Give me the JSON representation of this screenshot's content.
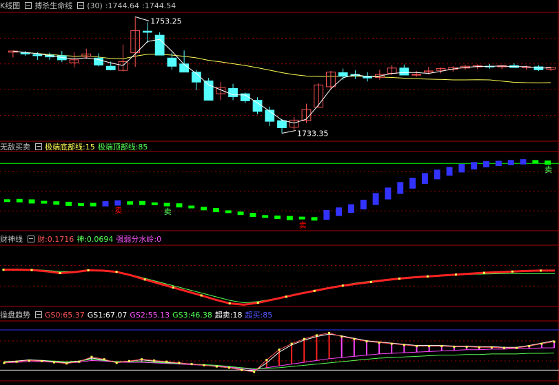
{
  "colors": {
    "up": "#ff5555",
    "down": "#55ffff",
    "line_white": "#ffffff",
    "line_yellow": "#ffff55",
    "green": "#00ff00",
    "blue": "#3333ff",
    "red": "#ff0000",
    "magenta": "#ff44ff",
    "grid": "#aa0000",
    "frame": "#aa0000"
  },
  "panel1": {
    "title": "K线图",
    "indicator": "搏杀生命线",
    "params": "(30)",
    "v1": ":1744.64",
    "v2": ":1744.54",
    "high_label": "1753.25",
    "low_label": "1733.35"
  },
  "panel2": {
    "title": "无敌买卖",
    "ind": "极端底部线",
    "ind_val": ":15",
    "top_label": "极端顶部线",
    "top_val": ":85",
    "sell_text": "卖"
  },
  "panel3": {
    "title": "财神线",
    "cai": "财:0.1716",
    "shen": "神:0.0694",
    "qr": "强弱分水岭:0"
  },
  "panel4": {
    "title": "操盘趋势",
    "gs0": "GS0:65.37",
    "gs1": "GS1:67.07",
    "gs2": "GS2:55.13",
    "gs3": "GS3:46.38",
    "cm": "超卖:18",
    "cb": "超买:85"
  },
  "chart_data": [
    {
      "type": "candlestick",
      "title": "K线图",
      "candles": [
        [
          1747.2,
          1747.4,
          1746.3,
          1747.4
        ],
        [
          1747.1,
          1747.4,
          1746.6,
          1746.9
        ],
        [
          1746.8,
          1747.2,
          1745.9,
          1746.6
        ],
        [
          1746.7,
          1747.1,
          1745.9,
          1746.4
        ],
        [
          1746.6,
          1747.4,
          1745.5,
          1745.9
        ],
        [
          1745.4,
          1747.2,
          1744.6,
          1745.9
        ],
        [
          1746.5,
          1747.8,
          1746.0,
          1746.9
        ],
        [
          1746.2,
          1747.0,
          1744.8,
          1745.0
        ],
        [
          1744.8,
          1745.6,
          1744.1,
          1744.2
        ],
        [
          1744.1,
          1748.5,
          1743.9,
          1745.6
        ],
        [
          1747.1,
          1753.25,
          1744.7,
          1750.9
        ],
        [
          1750.8,
          1752.3,
          1748.8,
          1750.6
        ],
        [
          1750.1,
          1750.6,
          1746.9,
          1746.7
        ],
        [
          1746.2,
          1747.1,
          1744.2,
          1744.8
        ],
        [
          1745.2,
          1747.5,
          1744.0,
          1743.8
        ],
        [
          1743.8,
          1744.2,
          1740.7,
          1742.1
        ],
        [
          1742.3,
          1742.8,
          1739.0,
          1739.0
        ],
        [
          1740.1,
          1742.1,
          1739.0,
          1741.2
        ],
        [
          1741.0,
          1741.8,
          1739.0,
          1739.6
        ],
        [
          1740.1,
          1740.3,
          1738.5,
          1738.9
        ],
        [
          1739.0,
          1739.5,
          1736.6,
          1737.1
        ],
        [
          1737.3,
          1737.9,
          1734.6,
          1735.4
        ],
        [
          1735.5,
          1735.8,
          1733.35,
          1734.3
        ],
        [
          1734.4,
          1736.1,
          1733.9,
          1735.6
        ],
        [
          1735.5,
          1738.4,
          1735.1,
          1737.4
        ],
        [
          1737.8,
          1741.9,
          1737.8,
          1741.6
        ],
        [
          1741.3,
          1744.0,
          1741.0,
          1743.8
        ],
        [
          1743.7,
          1744.4,
          1742.5,
          1743.1
        ],
        [
          1743.4,
          1744.1,
          1742.6,
          1743.2
        ],
        [
          1743.1,
          1743.8,
          1742.2,
          1742.8
        ],
        [
          1742.9,
          1744.2,
          1742.5,
          1743.4
        ],
        [
          1743.6,
          1745.0,
          1743.3,
          1744.5
        ],
        [
          1744.5,
          1745.1,
          1743.3,
          1743.3
        ],
        [
          1743.4,
          1744.0,
          1743.0,
          1743.4
        ],
        [
          1743.8,
          1744.7,
          1743.4,
          1744.0
        ],
        [
          1744.1,
          1744.6,
          1743.6,
          1744.4
        ],
        [
          1744.3,
          1744.8,
          1743.9,
          1744.6
        ],
        [
          1744.5,
          1745.0,
          1744.2,
          1744.8
        ],
        [
          1744.7,
          1745.1,
          1744.3,
          1744.9
        ],
        [
          1744.8,
          1745.2,
          1744.4,
          1744.7
        ],
        [
          1744.7,
          1745.0,
          1744.3,
          1744.9
        ],
        [
          1744.9,
          1745.3,
          1744.6,
          1744.6
        ],
        [
          1744.6,
          1744.9,
          1744.2,
          1744.7
        ],
        [
          1744.7,
          1745.0,
          1744.0,
          1744.2
        ],
        [
          1744.3,
          1744.7,
          1744.0,
          1744.64
        ]
      ],
      "ylim": [
        1732,
        1754
      ]
    },
    {
      "type": "bar",
      "title": "无敌买卖",
      "ylim": [
        0,
        100
      ],
      "ref_lines": [
        15,
        85
      ],
      "values": [
        38,
        38,
        37,
        36,
        35,
        34,
        33,
        33,
        34,
        35,
        35,
        35,
        34,
        33,
        32,
        30,
        28,
        26,
        24,
        22,
        20,
        18,
        17,
        16,
        16,
        15,
        20,
        24,
        28,
        33,
        40,
        47,
        54,
        60,
        66,
        71,
        75,
        79,
        82,
        84,
        85,
        86,
        87,
        87,
        86
      ],
      "sell_markers": [
        9,
        13,
        24,
        44
      ]
    },
    {
      "type": "line",
      "title": "财神线",
      "ylim": [
        -1,
        1
      ],
      "series": [
        {
          "name": "财",
          "values": [
            0.2,
            0.2,
            0.19,
            0.15,
            0.09,
            0.12,
            0.18,
            0.17,
            0.13,
            0.02,
            -0.12,
            -0.25,
            -0.38,
            -0.51,
            -0.64,
            -0.78,
            -0.9,
            -0.94,
            -0.88,
            -0.78,
            -0.68,
            -0.58,
            -0.49,
            -0.4,
            -0.32,
            -0.26,
            -0.2,
            -0.14,
            -0.09,
            -0.05,
            -0.02,
            0.01,
            0.04,
            0.07,
            0.1,
            0.12,
            0.14,
            0.16,
            0.17,
            0.17
          ]
        },
        {
          "name": "神",
          "values": [
            0.22,
            0.22,
            0.21,
            0.18,
            0.14,
            0.14,
            0.17,
            0.16,
            0.12,
            0.04,
            -0.08,
            -0.2,
            -0.32,
            -0.44,
            -0.56,
            -0.68,
            -0.8,
            -0.88,
            -0.84,
            -0.76,
            -0.66,
            -0.56,
            -0.47,
            -0.38,
            -0.3,
            -0.23,
            -0.17,
            -0.12,
            -0.07,
            -0.03,
            0.0,
            0.02,
            0.04,
            0.05,
            0.06,
            0.07,
            0.07,
            0.07,
            0.07,
            0.07
          ]
        }
      ],
      "ref_line": 0
    },
    {
      "type": "line",
      "title": "操盘趋势",
      "ylim": [
        0,
        100
      ],
      "series": [
        {
          "name": "GS0",
          "values": [
            30,
            32,
            34,
            33,
            31,
            29,
            32,
            40,
            36,
            30,
            33,
            36,
            34,
            32,
            30,
            28,
            26,
            24,
            22,
            18,
            15,
            35,
            52,
            62,
            70,
            76,
            80,
            74,
            70,
            66,
            64,
            62,
            60,
            58,
            58,
            58,
            57,
            57,
            56,
            56,
            55,
            55,
            58,
            62,
            65.37
          ]
        },
        {
          "name": "GS1",
          "values": [
            31,
            33,
            35,
            34,
            32,
            30,
            33,
            38,
            35,
            31,
            33,
            35,
            33,
            31,
            30,
            28,
            26,
            24,
            22,
            19,
            16,
            30,
            48,
            60,
            68,
            74,
            78,
            75,
            71,
            67,
            65,
            63,
            61,
            59,
            59,
            59,
            58,
            58,
            57,
            57,
            56,
            56,
            59,
            63,
            67.07
          ]
        },
        {
          "name": "GS2",
          "values": [
            30,
            31,
            32,
            32,
            31,
            30,
            31,
            34,
            33,
            31,
            31,
            31,
            30,
            29,
            28,
            27,
            26,
            25,
            23,
            21,
            19,
            22,
            25,
            28,
            31,
            34,
            37,
            39,
            41,
            43,
            45,
            46,
            47,
            48,
            49,
            50,
            51,
            52,
            52,
            53,
            53,
            54,
            54,
            55,
            55.13
          ]
        },
        {
          "name": "GS3",
          "values": [
            32,
            33,
            34,
            34,
            33,
            32,
            33,
            36,
            34,
            32,
            32,
            32,
            31,
            30,
            29,
            28,
            27,
            26,
            24,
            22,
            20,
            21,
            22,
            24,
            26,
            28,
            30,
            32,
            34,
            36,
            38,
            39,
            40,
            41,
            42,
            43,
            43,
            44,
            44,
            45,
            45,
            45,
            46,
            46,
            46.38
          ]
        }
      ],
      "ref_lines": [
        18,
        85
      ]
    }
  ]
}
